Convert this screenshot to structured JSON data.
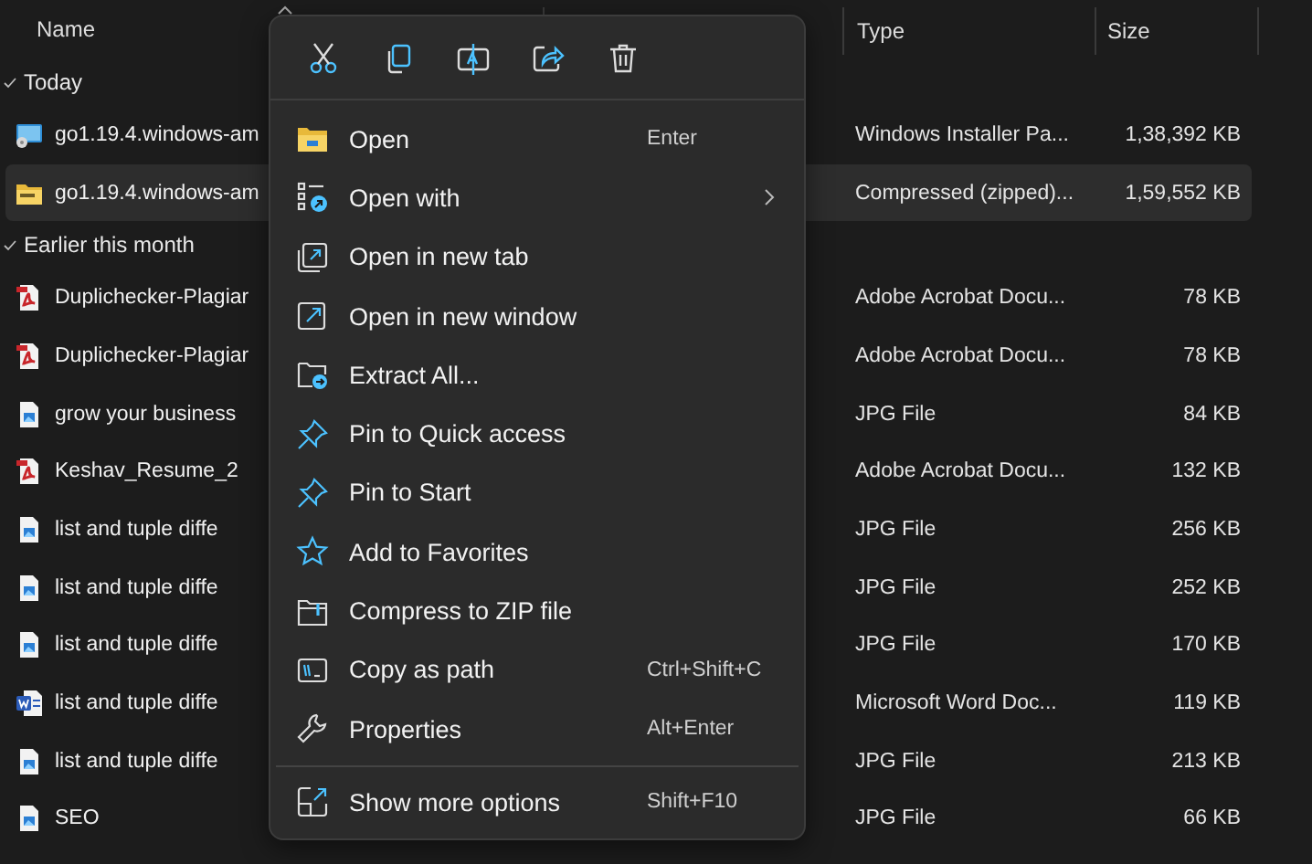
{
  "header": {
    "columns": [
      {
        "label": "Name"
      },
      {
        "label": "Type"
      },
      {
        "label": "Size"
      }
    ]
  },
  "groups": [
    {
      "label": "Today",
      "expanded": true,
      "rows": [
        {
          "name": "go1.19.4.windows-am",
          "kind": "installer",
          "type": "Windows Installer Pa...",
          "size": "1,38,392 KB",
          "selected": false
        },
        {
          "name": "go1.19.4.windows-am",
          "kind": "zip",
          "type": "Compressed (zipped)...",
          "size": "1,59,552 KB",
          "selected": true
        }
      ]
    },
    {
      "label": "Earlier this month",
      "expanded": true,
      "rows": [
        {
          "name": "Duplichecker-Plagiar",
          "kind": "pdf",
          "type": "Adobe Acrobat Docu...",
          "size": "78 KB",
          "selected": false
        },
        {
          "name": "Duplichecker-Plagiar",
          "kind": "pdf",
          "type": "Adobe Acrobat Docu...",
          "size": "78 KB",
          "selected": false
        },
        {
          "name": "grow your business",
          "kind": "image",
          "type": "JPG File",
          "size": "84 KB",
          "selected": false
        },
        {
          "name": "Keshav_Resume_2",
          "kind": "pdf",
          "type": "Adobe Acrobat Docu...",
          "size": "132 KB",
          "selected": false
        },
        {
          "name": "list and tuple diffe",
          "kind": "image",
          "type": "JPG File",
          "size": "256 KB",
          "selected": false
        },
        {
          "name": "list and tuple diffe",
          "kind": "image",
          "type": "JPG File",
          "size": "252 KB",
          "selected": false
        },
        {
          "name": "list and tuple diffe",
          "kind": "image",
          "type": "JPG File",
          "size": "170 KB",
          "selected": false
        },
        {
          "name": "list and tuple diffe",
          "kind": "word",
          "type": "Microsoft Word Doc...",
          "size": "119 KB",
          "selected": false
        },
        {
          "name": "list and tuple diffe",
          "kind": "image",
          "type": "JPG File",
          "size": "213 KB",
          "selected": false
        },
        {
          "name": "SEO",
          "kind": "image",
          "type": "JPG File",
          "size": "66 KB",
          "selected": false
        }
      ]
    }
  ],
  "context_menu": {
    "quick_actions": [
      {
        "kind": "cut"
      },
      {
        "kind": "copy"
      },
      {
        "kind": "rename"
      },
      {
        "kind": "share"
      },
      {
        "kind": "delete"
      }
    ],
    "items": [
      {
        "label": "Open",
        "shortcut": "Enter",
        "kind": "open",
        "submenu": false
      },
      {
        "label": "Open with",
        "kind": "open_with",
        "submenu": true
      },
      {
        "label": "Open in new tab",
        "kind": "new_tab",
        "submenu": false
      },
      {
        "label": "Open in new window",
        "kind": "new_window",
        "submenu": false
      },
      {
        "label": "Extract All...",
        "kind": "extract",
        "submenu": false
      },
      {
        "label": "Pin to Quick access",
        "kind": "pin",
        "submenu": false
      },
      {
        "label": "Pin to Start",
        "kind": "pin",
        "submenu": false
      },
      {
        "label": "Add to Favorites",
        "kind": "star",
        "submenu": false
      },
      {
        "label": "Compress to ZIP file",
        "kind": "zip",
        "submenu": false
      },
      {
        "label": "Copy as path",
        "shortcut": "Ctrl+Shift+C",
        "kind": "path",
        "submenu": false
      },
      {
        "label": "Properties",
        "shortcut": "Alt+Enter",
        "kind": "properties",
        "submenu": false
      }
    ],
    "footer_item": {
      "label": "Show more options",
      "shortcut": "Shift+F10",
      "kind": "more",
      "submenu": false
    }
  }
}
